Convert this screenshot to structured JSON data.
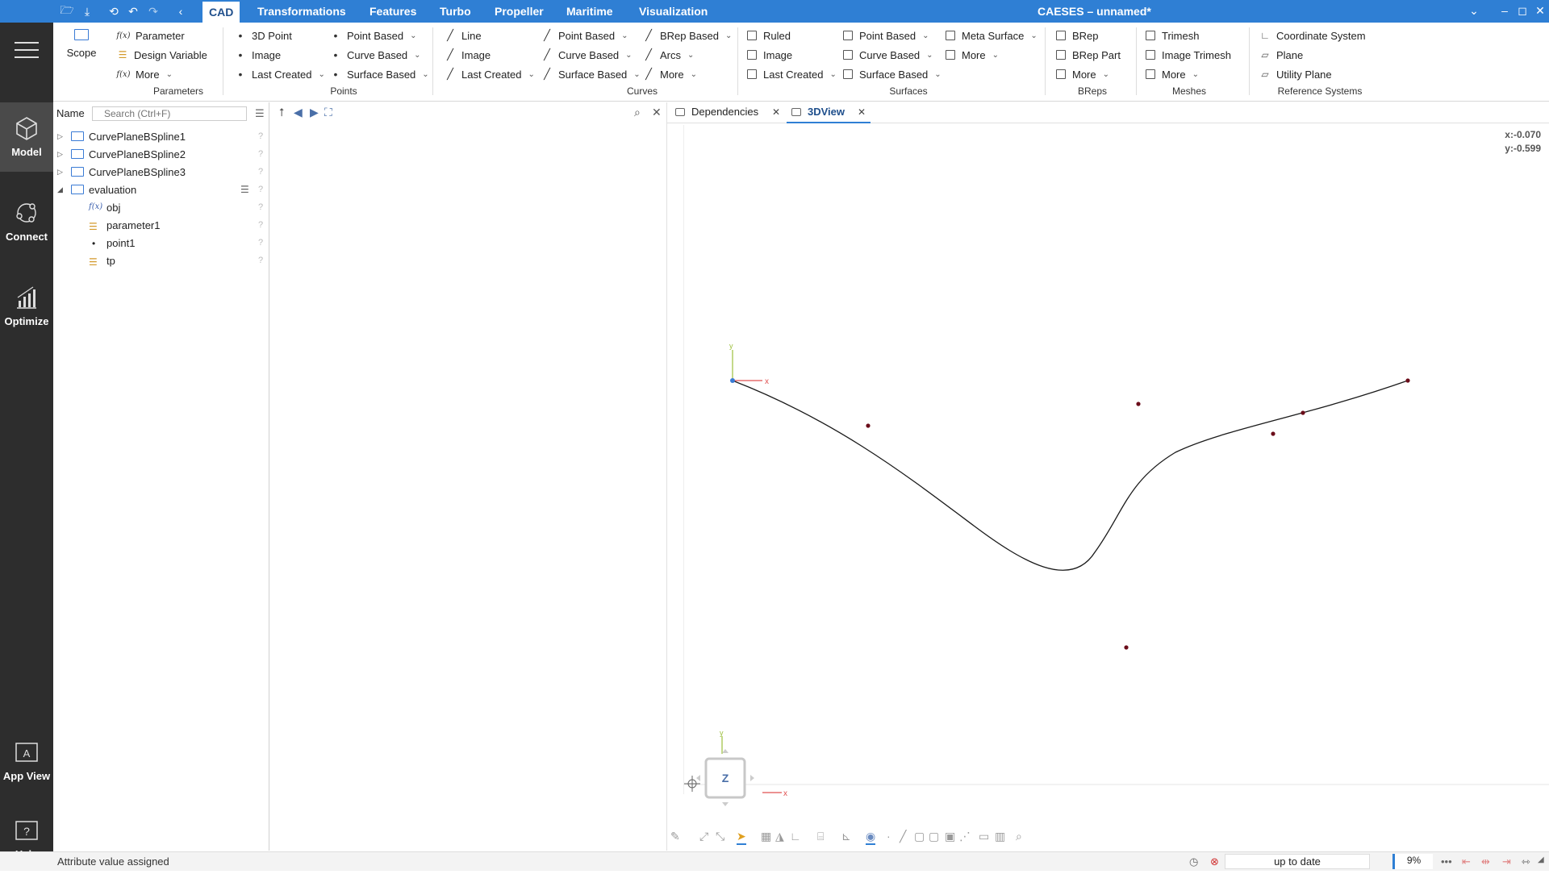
{
  "window": {
    "title": "CAESES – unnamed*"
  },
  "menu": {
    "tabs": [
      "CAD",
      "Transformations",
      "Features",
      "Turbo",
      "Propeller",
      "Maritime",
      "Visualization"
    ],
    "active": "CAD"
  },
  "rail": {
    "items": [
      {
        "label": "Model",
        "icon": "cube-icon"
      },
      {
        "label": "Connect",
        "icon": "connect-icon"
      },
      {
        "label": "Optimize",
        "icon": "chart-icon"
      },
      {
        "label": "App View",
        "icon": "app-view-icon"
      },
      {
        "label": "Help",
        "icon": "help-icon"
      }
    ]
  },
  "ribbon": {
    "scope": "Scope",
    "parameters": {
      "group": "Parameters",
      "items": [
        "Parameter",
        "Design Variable",
        "More"
      ]
    },
    "points": {
      "group": "Points",
      "col1": [
        "3D Point",
        "Image",
        "Last Created"
      ],
      "col2": [
        "Point Based",
        "Curve Based",
        "Surface Based"
      ]
    },
    "curves": {
      "group": "Curves",
      "col1": [
        "Line",
        "Image",
        "Last Created"
      ],
      "col2": [
        "Point Based",
        "Curve Based",
        "Surface Based"
      ],
      "col3": [
        "BRep Based",
        "Arcs",
        "More"
      ]
    },
    "surfaces": {
      "group": "Surfaces",
      "col1": [
        "Ruled",
        "Image",
        "Last Created"
      ],
      "col2": [
        "Point Based",
        "Curve Based",
        "Surface Based"
      ],
      "col3": [
        "Meta Surface",
        "More"
      ]
    },
    "breps": {
      "group": "BReps",
      "items": [
        "BRep",
        "BRep Part",
        "More"
      ]
    },
    "meshes": {
      "group": "Meshes",
      "items": [
        "Trimesh",
        "Image Trimesh",
        "More"
      ]
    },
    "refsys": {
      "group": "Reference Systems",
      "items": [
        "Coordinate System",
        "Plane",
        "Utility Plane"
      ]
    }
  },
  "tree": {
    "header": "Name",
    "search_placeholder": "Search (Ctrl+F)",
    "rows": [
      {
        "label": "CurvePlaneBSpline1",
        "type": "folder",
        "level": 0,
        "expand": "collapsed"
      },
      {
        "label": "CurvePlaneBSpline2",
        "type": "folder",
        "level": 0,
        "expand": "collapsed"
      },
      {
        "label": "CurvePlaneBSpline3",
        "type": "folder",
        "level": 0,
        "expand": "collapsed"
      },
      {
        "label": "evaluation",
        "type": "folder",
        "level": 0,
        "expand": "expanded"
      },
      {
        "label": "obj",
        "type": "function",
        "level": 1
      },
      {
        "label": "parameter1",
        "type": "parameter",
        "level": 1
      },
      {
        "label": "point1",
        "type": "point",
        "level": 1
      },
      {
        "label": "tp",
        "type": "parameter",
        "level": 1
      }
    ]
  },
  "viewer": {
    "tabs": [
      {
        "label": "Dependencies",
        "active": false
      },
      {
        "label": "3DView",
        "active": true
      }
    ],
    "coords": {
      "x": "x:-0.070",
      "y": "y:-0.599"
    },
    "axis_labels": {
      "x": "x",
      "y": "y",
      "z": "Z"
    },
    "colors": {
      "curve": "#1a1a1a",
      "point": "#6b0d1a",
      "axis_x": "#e05050",
      "axis_y": "#9cbf3c",
      "origin": "#3a7bd5"
    }
  },
  "status": {
    "message": "Attribute value assigned",
    "update_state": "up to date",
    "zoom": "9%"
  }
}
